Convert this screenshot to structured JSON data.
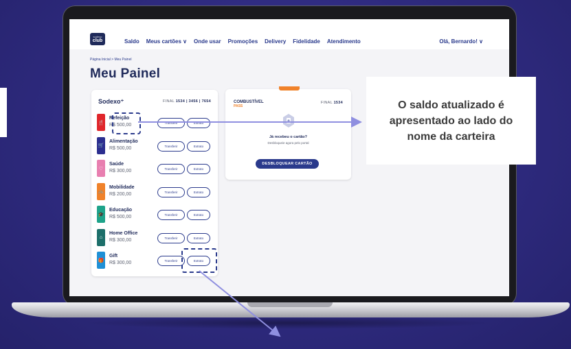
{
  "header": {
    "logo_top": "sodexo",
    "logo_main": "club",
    "nav": [
      "Saldo",
      "Meus cartões ∨",
      "Onde usar",
      "Promoções",
      "Delivery",
      "Fidelidade",
      "Atendimento"
    ],
    "greeting": "Olá, Bernardo!  ∨"
  },
  "breadcrumb": "Página Inicial > Meu Painel",
  "page_title": "Meu Painel",
  "main_card": {
    "brand": "Sodexo⁺",
    "final_label": "FINAL",
    "final_numbers": "1534 | 3456 | 7654",
    "transfer_label": "Transferir",
    "extract_label": "Extrato",
    "wallets": [
      {
        "name": "Refeição",
        "balance": "R$ 500,00",
        "color": "#e0262b",
        "icon": "utensils-icon",
        "glyph": "🍴"
      },
      {
        "name": "Alimentação",
        "balance": "R$ 500,00",
        "color": "#2b2e8f",
        "icon": "cart-icon",
        "glyph": "🛒"
      },
      {
        "name": "Saúde",
        "balance": "R$ 300,00",
        "color": "#e87fb0",
        "icon": "heart-icon",
        "glyph": "♡"
      },
      {
        "name": "Mobilidade",
        "balance": "R$ 200,00",
        "color": "#f0822a",
        "icon": "bike-icon",
        "glyph": "🚲"
      },
      {
        "name": "Educação",
        "balance": "R$ 500,00",
        "color": "#1ea38a",
        "icon": "graduation-icon",
        "glyph": "🎓"
      },
      {
        "name": "Home Office",
        "balance": "R$ 300,00",
        "color": "#1d6f6a",
        "icon": "home-icon",
        "glyph": "⌂"
      },
      {
        "name": "Gift",
        "balance": "R$ 300,00",
        "color": "#1e90d6",
        "icon": "gift-icon",
        "glyph": "🎁"
      }
    ]
  },
  "fuel_card": {
    "logo": "COMBUSTÍVEL",
    "logo_sub": "PASS",
    "final_label": "FINAL",
    "final_number": "1534",
    "question": "Já recebeu o cartão?",
    "subtitle": "Desbloqueie agora pelo portal",
    "button": "DESBLOQUEAR CARTÃO"
  },
  "callout": "O saldo  atualizado é apresentado ao lado do nome da carteira",
  "colors": {
    "primary": "#2a3a8c",
    "accent": "#f0822a",
    "background": "#2e2a7e"
  }
}
